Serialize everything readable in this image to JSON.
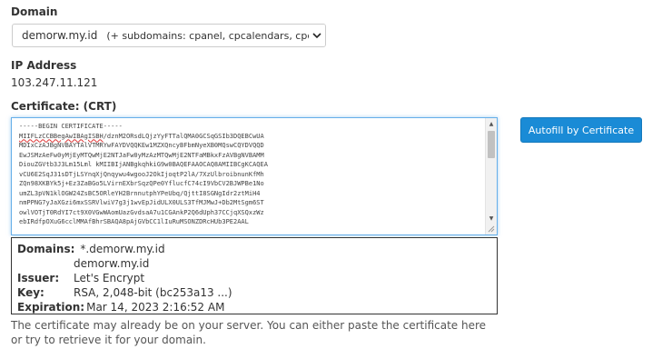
{
  "domain": {
    "label": "Domain",
    "selected": "demorw.my.id",
    "subdomains": "(+ subdomains: cpanel, cpcalendars, cpcc"
  },
  "ip": {
    "label": "IP Address",
    "value": "103.247.11.121"
  },
  "certificate": {
    "label": "Certificate: (CRT)",
    "begin_line": "-----BEGIN CERTIFICATE-----",
    "first_line_flagged": "MIIFLzCCBBegAwIBAgISBH",
    "first_line_rest": "/dznM2ORsdLQjzYyFTTalQMA0GCSqGSIb3DQEBCwUA",
    "lines": [
      "MDIxCzAJBgNVBAYTAlVTMRYwFAYDVQQKEw1MZXQncyBFbmNyeXB0MQswCQYDVQQD",
      "EwJSMzAeFw0yMjEyMTQwMjE2NTJaFw0yMzAzMTQwMjE2NTFaMBkxFzAVBgNVBAMM",
      "DiouZGVtb3J3Lm15Lml kMIIBIjANBgkqhkiG9w0BAQEFAAOCAQ8AMIIBCgKCAQEA",
      "vCU6E2SqJ31sDTjLSYnqXjQnqywu4wgooJ2OkIjoqtP2lA/7XzUlbroibnunKfMh",
      "ZQn98XKBYk5j+Ez3ZaBGo5LVirnEXbrSqzQPe0YflucfC74cI9VbCV2BJWPBe1No",
      "umZL3pVN1klOGW24ZsBC5ORleYH2BrnnutphYPeUbq/QjttI8SGNgIdr2ztMiH4",
      "nmPPNG7yJaXGzi6mxSSRVlwiV7g3j1wvEpJidULX0ULS3TfMJMwJ+Db2MtSgm6ST",
      "owlVOTjT0RdYI7ct9X0VGwWAomUazGvdsaA7u1CGAnkP2Q6dUph37CCjqXSQxzWz",
      "ebIRdfpOXuG6cclMMAfBhrSBAQA8pAjGVbCC1lIuRuMSONZDRcHUb3PE2AAL"
    ],
    "autofill_label": "Autofill by Certificate"
  },
  "details": {
    "domains_label": "Domains:",
    "domains": [
      "*.demorw.my.id",
      "demorw.my.id"
    ],
    "issuer_label": "Issuer:",
    "issuer": "Let's Encrypt",
    "key_label": "Key:",
    "key": "RSA, 2,048-bit (bc253a13 ...)",
    "expiration_label": "Expiration:",
    "expiration": "Mar 14, 2023 2:16:52 AM"
  },
  "help_text": "The certificate may already be on your server. You can either paste the certificate here or try to retrieve it for your domain.",
  "colors": {
    "accent": "#1a8bd6",
    "focus_border": "#66afe9"
  },
  "icons": {
    "select_arrow": "chevron-down-icon",
    "scroll_up": "scroll-up-arrow-icon",
    "scroll_down": "scroll-down-arrow-icon",
    "resize": "resize-grip-icon"
  }
}
